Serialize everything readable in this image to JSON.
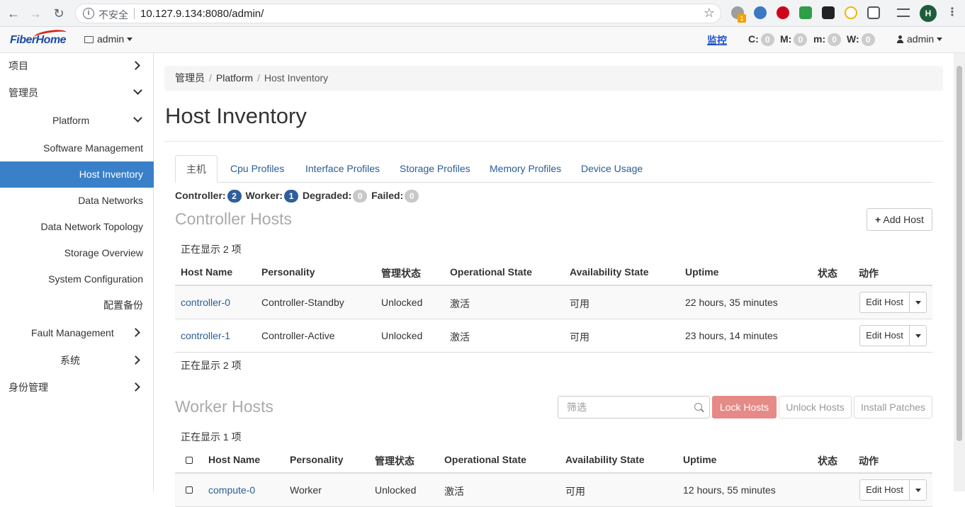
{
  "browser": {
    "url": "10.127.9.134:8080/admin/",
    "security_label": "不安全",
    "profile_initial": "H",
    "ext_badge": "1"
  },
  "header": {
    "logo": "FiberHome",
    "project_dropdown": "admin",
    "monitor_link": "监控",
    "alarms": [
      {
        "label": "C:",
        "count": "0"
      },
      {
        "label": "M:",
        "count": "0"
      },
      {
        "label": "m:",
        "count": "0"
      },
      {
        "label": "W:",
        "count": "0"
      }
    ],
    "user": "admin"
  },
  "sidebar": {
    "items": [
      {
        "label": "项目",
        "icon": "chevron-right-icon"
      },
      {
        "label": "管理员",
        "icon": "chevron-down-icon"
      },
      {
        "label": "Platform",
        "icon": "chevron-down-icon"
      },
      {
        "label": "Software Management"
      },
      {
        "label": "Host Inventory",
        "active": true
      },
      {
        "label": "Data Networks"
      },
      {
        "label": "Data Network Topology"
      },
      {
        "label": "Storage Overview"
      },
      {
        "label": "System Configuration"
      },
      {
        "label": "配置备份"
      },
      {
        "label": "Fault Management",
        "icon": "chevron-right-icon"
      },
      {
        "label": "系统",
        "icon": "chevron-right-icon"
      },
      {
        "label": "身份管理",
        "icon": "chevron-right-icon"
      }
    ]
  },
  "breadcrumb": [
    "管理员",
    "Platform",
    "Host Inventory"
  ],
  "page_title": "Host Inventory",
  "tabs": [
    "主机",
    "Cpu Profiles",
    "Interface Profiles",
    "Storage Profiles",
    "Memory Profiles",
    "Device Usage"
  ],
  "summary": [
    {
      "label": "Controller:",
      "count": "2"
    },
    {
      "label": "Worker:",
      "count": "1"
    },
    {
      "label": "Degraded:",
      "count": "0"
    },
    {
      "label": "Failed:",
      "count": "0"
    }
  ],
  "controller": {
    "title": "Controller Hosts",
    "add_button": "Add Host",
    "count_text": "正在显示 2 项",
    "columns": [
      "Host Name",
      "Personality",
      "管理状态",
      "Operational State",
      "Availability State",
      "Uptime",
      "状态",
      "动作"
    ],
    "rows": [
      {
        "name": "controller-0",
        "personality": "Controller-Standby",
        "admin": "Unlocked",
        "oper": "激活",
        "avail": "可用",
        "uptime": "22 hours, 35 minutes",
        "status": "",
        "action": "Edit Host"
      },
      {
        "name": "controller-1",
        "personality": "Controller-Active",
        "admin": "Unlocked",
        "oper": "激活",
        "avail": "可用",
        "uptime": "23 hours, 14 minutes",
        "status": "",
        "action": "Edit Host"
      }
    ]
  },
  "worker": {
    "title": "Worker Hosts",
    "filter_placeholder": "筛选",
    "buttons": {
      "lock": "Lock Hosts",
      "unlock": "Unlock Hosts",
      "patch": "Install Patches"
    },
    "count_text": "正在显示 1 项",
    "columns": [
      "Host Name",
      "Personality",
      "管理状态",
      "Operational State",
      "Availability State",
      "Uptime",
      "状态",
      "动作"
    ],
    "rows": [
      {
        "name": "compute-0",
        "personality": "Worker",
        "admin": "Unlocked",
        "oper": "激活",
        "avail": "可用",
        "uptime": "12 hours, 55 minutes",
        "status": "",
        "action": "Edit Host"
      }
    ]
  }
}
